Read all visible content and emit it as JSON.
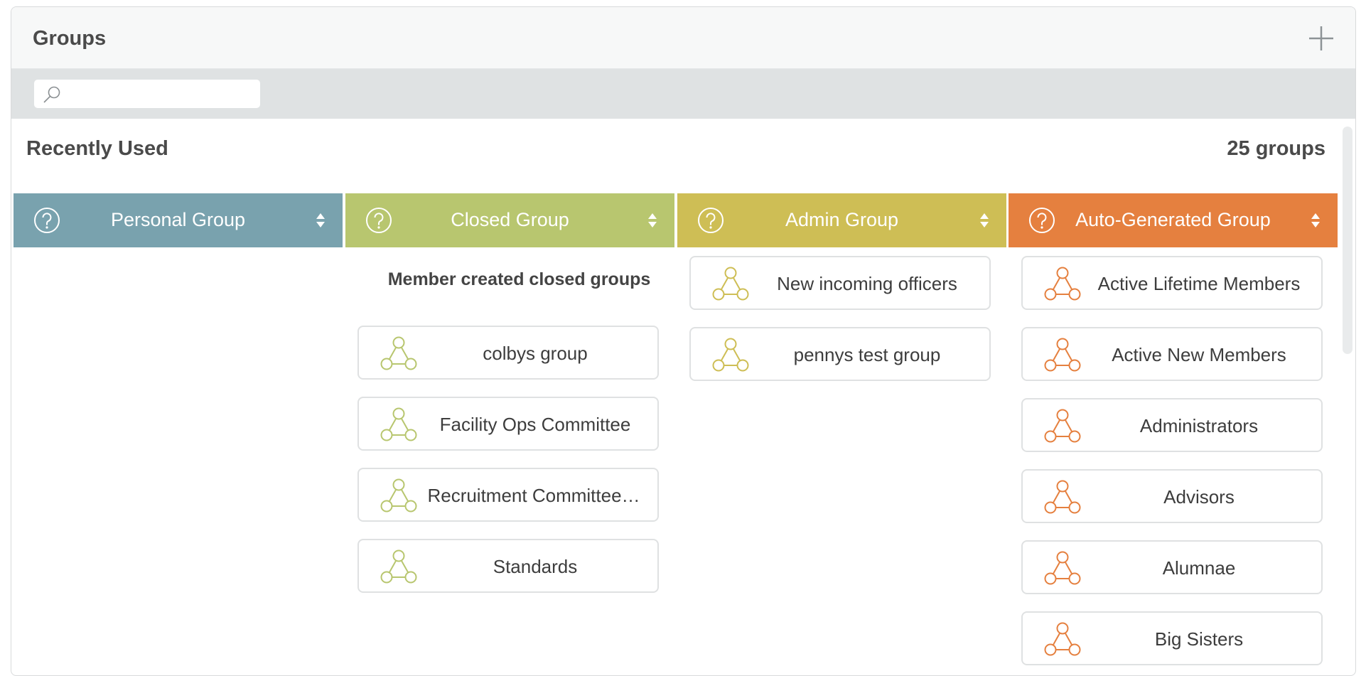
{
  "header": {
    "title": "Groups"
  },
  "search": {
    "placeholder": ""
  },
  "section": {
    "title": "Recently Used",
    "count": "25 groups"
  },
  "columns": [
    {
      "label": "Personal Group",
      "color": "#79a2ae"
    },
    {
      "label": "Closed Group",
      "color": "#b8c66f",
      "subheading": "Member created closed groups",
      "items": [
        "colbys group",
        "Facility Ops Committee",
        "Recruitment Committee…",
        "Standards"
      ]
    },
    {
      "label": "Admin Group",
      "color": "#cebe55",
      "items": [
        "New incoming officers",
        "pennys test group"
      ]
    },
    {
      "label": "Auto-Generated Group",
      "color": "#e5803f",
      "items": [
        "Active Lifetime Members",
        "Active New Members",
        "Administrators",
        "Advisors",
        "Alumnae",
        "Big Sisters"
      ]
    }
  ],
  "icons": {
    "help": "help-icon",
    "sort": "sort-icon",
    "group": "group-network-icon",
    "add": "plus-icon",
    "search": "search-icon"
  }
}
